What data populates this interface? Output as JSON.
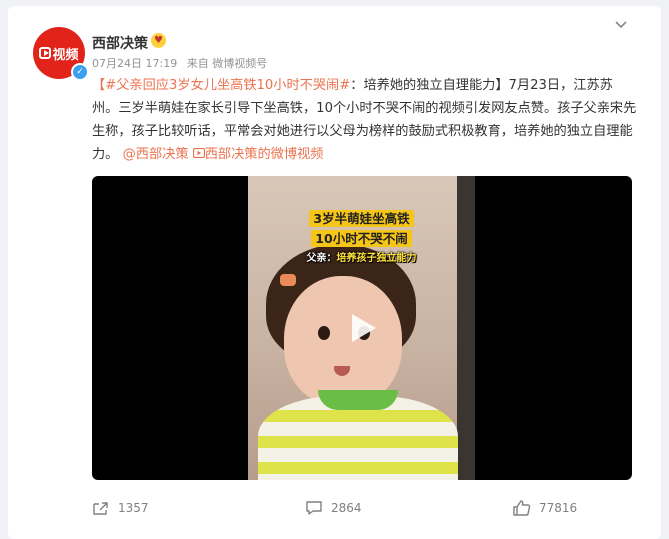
{
  "post": {
    "author": "西部决策",
    "author_emoji": "😍",
    "avatar_text": "视频",
    "date": "07月24日 17:19",
    "source": "来自 微博视频号",
    "hashtag": "【#父亲回应3岁女儿坐高铁10小时不哭闹#",
    "body_1": "：培养她的独立自理能力】7月23日，江苏苏州。三岁半萌娃在家长引导下坐高铁，10个小时不哭不闹的视频引发网友点赞。孩子父亲宋先生称，孩子比较听话，平常会对她进行以父母为榜样的鼓励式积极教育，培养她的独立自理能力。",
    "mention": "@西部决策",
    "video_link": "西部决策的微博视频"
  },
  "video": {
    "caption_1": "3岁半萌娃坐高铁",
    "caption_2": "10小时不哭不闹",
    "caption_3_prefix": "父亲：",
    "caption_3_rest": "培养孩子独立能力"
  },
  "actions": {
    "repost_count": "1357",
    "comment_count": "2864",
    "like_count": "77816"
  },
  "colors": {
    "link": "#eb7350",
    "avatar_bg": "#e2231a",
    "verify": "#3b9ff0"
  }
}
